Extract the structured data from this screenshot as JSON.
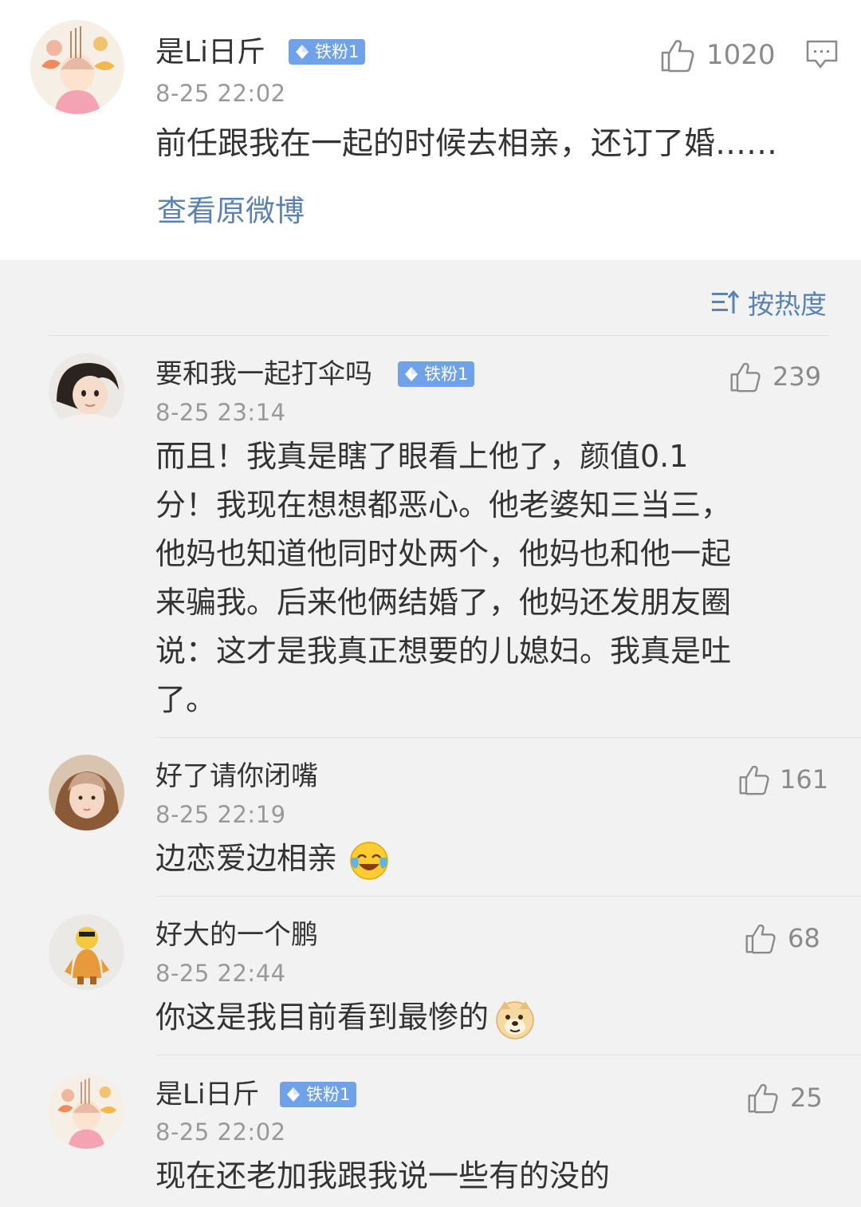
{
  "post": {
    "username": "是Li日斤",
    "badge": "铁粉1",
    "likes": "1020",
    "time": "8-25 22:02",
    "text": "前任跟我在一起的时候去相亲，还订了婚……",
    "view_original": "查看原微博"
  },
  "sort_label": "按热度",
  "comments": [
    {
      "username": "要和我一起打伞吗",
      "badge": "铁粉1",
      "likes": "239",
      "time": "8-25 23:14",
      "lines": [
        "而且！我真是瞎了眼看上他了，颜值0.1",
        "分！我现在想想都恶心。他老婆知三当三，",
        "他妈也知道他同时处两个，他妈也和他一起",
        "来骗我。后来他俩结婚了，他妈还发朋友圈",
        "说：这才是我真正想要的儿媳妇。我真是吐",
        "了。"
      ]
    },
    {
      "username": "好了请你闭嘴",
      "likes": "161",
      "time": "8-25 22:19",
      "text": "边恋爱边相亲",
      "emoji": "laugh-cry"
    },
    {
      "username": "好大的一个鹏",
      "likes": "68",
      "time": "8-25 22:44",
      "text": "你这是我目前看到最惨的",
      "emoji": "doge"
    },
    {
      "username": "是Li日斤",
      "badge": "铁粉1",
      "likes": "25",
      "time": "8-25 22:02",
      "text": "现在还老加我跟我说一些有的没的"
    }
  ],
  "icons": {
    "like": "thumbs-up-icon",
    "comment": "comment-icon",
    "sort": "sort-icon",
    "badge": "diamond-icon"
  },
  "colors": {
    "link": "#5b82b4",
    "badge": "#6fa2e8",
    "background": "#f2f2f2"
  }
}
